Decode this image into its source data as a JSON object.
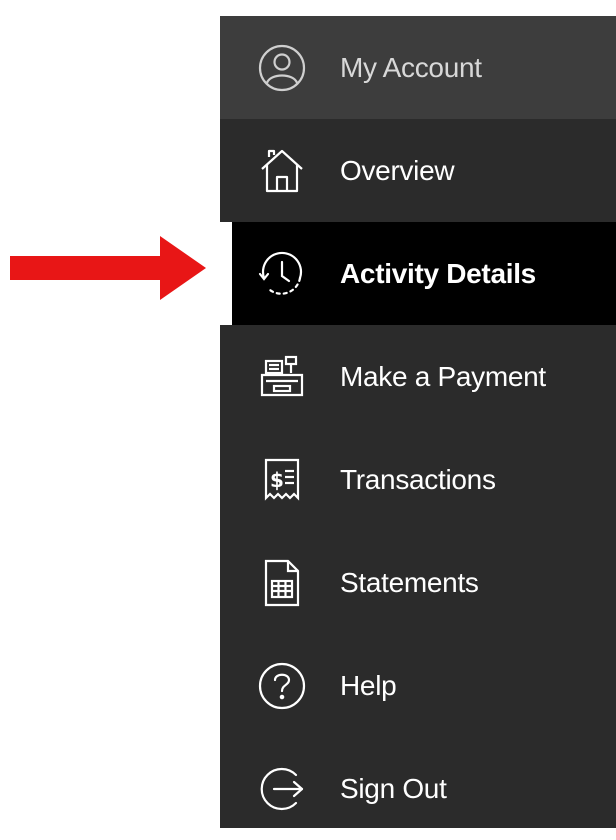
{
  "colors": {
    "sidebar_bg": "#2b2b2b",
    "header_bg": "#3d3d3d",
    "active_bg": "#000000",
    "active_indicator": "#ffffff",
    "annotation_arrow": "#e81616"
  },
  "sidebar": {
    "items": [
      {
        "label": "My Account",
        "icon": "user-circle-icon",
        "active": false
      },
      {
        "label": "Overview",
        "icon": "home-icon",
        "active": false
      },
      {
        "label": "Activity Details",
        "icon": "clock-history-icon",
        "active": true
      },
      {
        "label": "Make a Payment",
        "icon": "cash-register-icon",
        "active": false
      },
      {
        "label": "Transactions",
        "icon": "receipt-icon",
        "active": false
      },
      {
        "label": "Statements",
        "icon": "document-table-icon",
        "active": false
      },
      {
        "label": "Help",
        "icon": "question-circle-icon",
        "active": false
      },
      {
        "label": "Sign Out",
        "icon": "sign-out-icon",
        "active": false
      }
    ]
  }
}
